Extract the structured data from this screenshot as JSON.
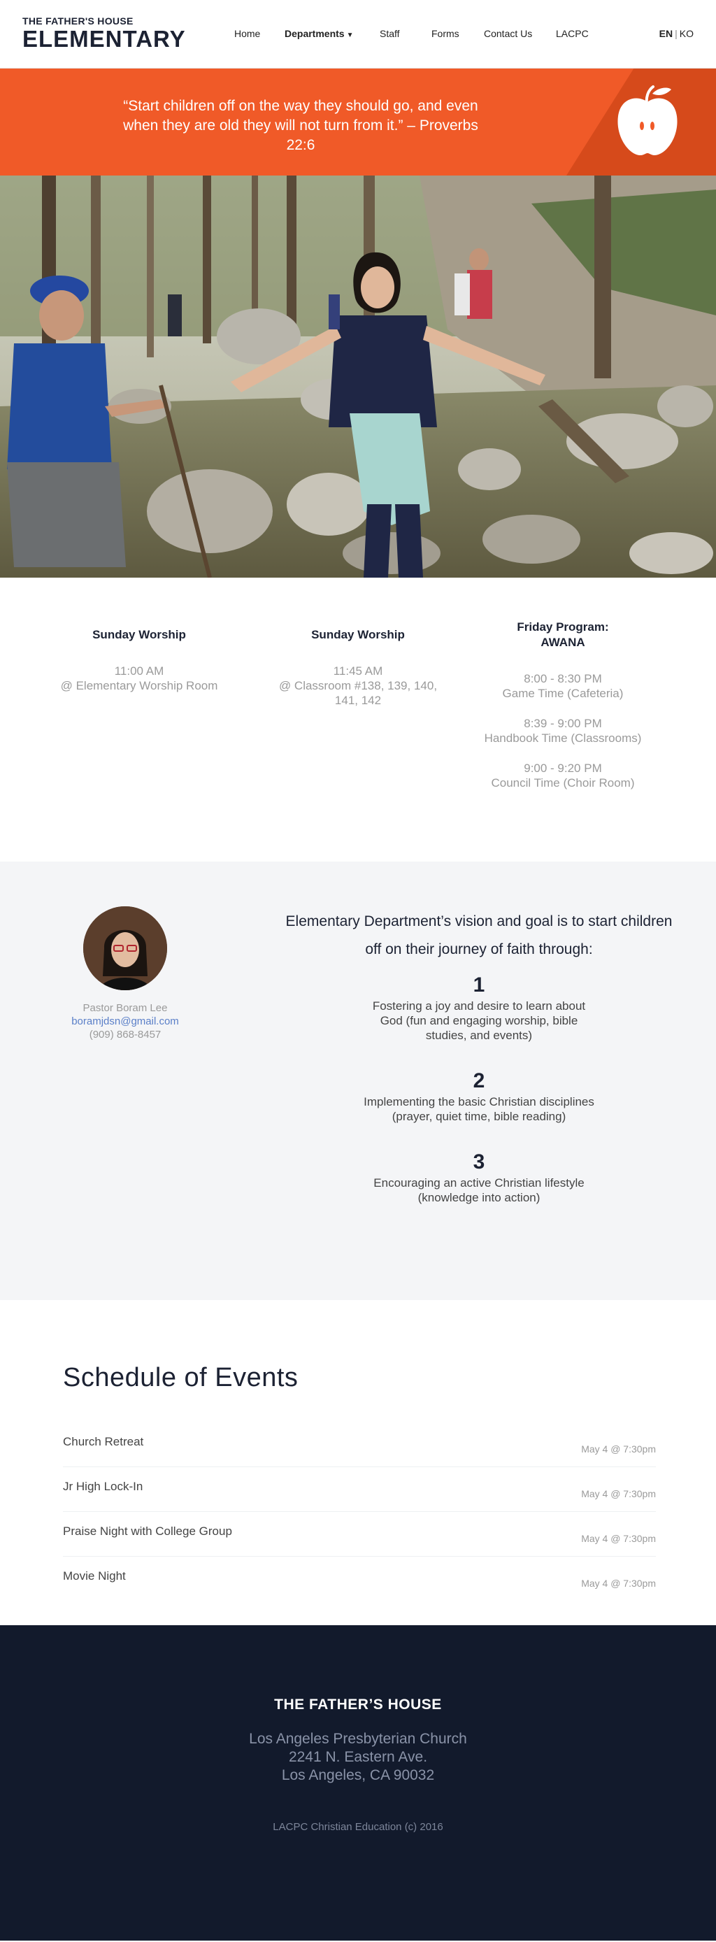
{
  "header": {
    "logo_top": "THE FATHER'S HOUSE",
    "logo_main": "ELEMENTARY",
    "nav": {
      "home": "Home",
      "departments": "Departments",
      "staff": "Staff",
      "forms": "Forms",
      "contact": "Contact Us",
      "lacpc": "LACPC"
    },
    "lang_en": "EN",
    "lang_sep": "|",
    "lang_ko": "KO"
  },
  "banner": {
    "quote": "“Start children off on the way they should go, and even when they are old they will not turn from it.” – Proverbs 22:6",
    "icon": "apple-icon"
  },
  "photo": {
    "icon": "hero-photo"
  },
  "services": [
    {
      "title": "Sunday Worship",
      "blocks": [
        "11:00 AM\n@ Elementary Worship Room"
      ]
    },
    {
      "title": "Sunday Worship",
      "blocks": [
        "11:45 AM\n@ Classroom #138, 139, 140, 141, 142"
      ]
    },
    {
      "title": "Friday Program:\nAWANA",
      "blocks": [
        "8:00 - 8:30 PM\nGame Time (Cafeteria)",
        "8:39 - 9:00 PM\nHandbook Time (Classrooms)",
        "9:00 - 9:20 PM\nCouncil Time (Choir Room)"
      ]
    }
  ],
  "vision": {
    "pastor_name": "Pastor Boram Lee",
    "pastor_email": "boramjdsn@gmail.com",
    "pastor_phone": "(909) 868-8457",
    "heading": "Elementary Department’s vision and goal is to start children off on their journey of faith through:",
    "goals": [
      {
        "num": "1",
        "text": "Fostering a joy and desire to learn about God (fun and engaging worship, bible studies, and events)"
      },
      {
        "num": "2",
        "text": "Implementing the basic Christian disciplines (prayer, quiet time, bible reading)"
      },
      {
        "num": "3",
        "text": "Encouraging an active Christian lifestyle (knowledge into action)"
      }
    ]
  },
  "events": {
    "title": "Schedule of Events",
    "items": [
      {
        "name": "Church Retreat",
        "date": "May 4 @ 7:30pm"
      },
      {
        "name": "Jr High Lock-In",
        "date": "May 4 @ 7:30pm"
      },
      {
        "name": "Praise Night with College Group",
        "date": "May 4 @ 7:30pm"
      },
      {
        "name": "Movie Night",
        "date": "May 4 @ 7:30pm"
      }
    ]
  },
  "footer": {
    "title": "THE FATHER’S HOUSE",
    "address_line1": "Los Angeles Presbyterian Church",
    "address_line2": "2241 N. Eastern Ave.",
    "address_line3": "Los Angeles, CA 90032",
    "copyright": "LACPC Christian Education (c) 2016"
  },
  "colors": {
    "accent": "#f05a28",
    "navy": "#121a2c",
    "link": "#5a7fc8"
  }
}
